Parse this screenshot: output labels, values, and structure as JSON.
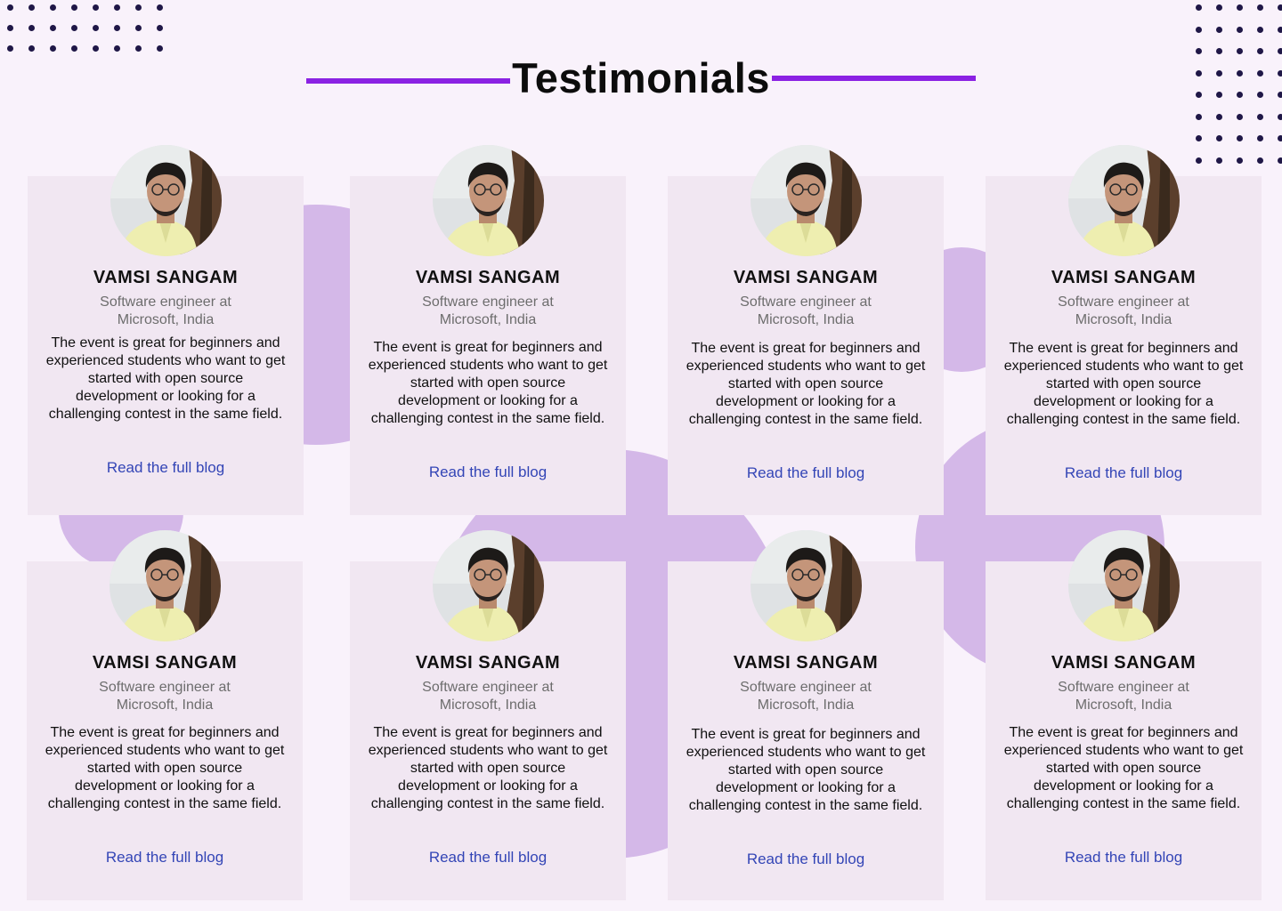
{
  "page": {
    "title": "Testimonials",
    "accent_color": "#8b22e3",
    "blob_color": "#d4b8e8",
    "link_color": "#3345b6"
  },
  "testimonials": [
    {
      "name": "VAMSI SANGAM",
      "role": "Software engineer at Microsoft, India",
      "quote": "The event is great for beginners and experienced students who want to get started with open source development or looking for a challenging contest in the same field.",
      "link": "Read the full blog"
    },
    {
      "name": "VAMSI SANGAM",
      "role": "Software engineer at Microsoft, India",
      "quote": "The event is great for beginners and experienced students who want to get started with open source development or looking for a challenging contest in the same field.",
      "link": "Read the full blog"
    },
    {
      "name": "VAMSI SANGAM",
      "role": "Software engineer at Microsoft, India",
      "quote": "The event is great for beginners and experienced students who want to get started with open source development or looking for a challenging contest in the same field.",
      "link": "Read the full blog"
    },
    {
      "name": "VAMSI SANGAM",
      "role": "Software engineer at Microsoft, India",
      "quote": "The event is great for beginners and experienced students who want to get started with open source development or looking for a challenging contest in the same field.",
      "link": "Read the full blog"
    },
    {
      "name": "VAMSI SANGAM",
      "role": "Software engineer at Microsoft, India",
      "quote": "The event is great for beginners and experienced students who want to get started with open source development or looking for a challenging contest in the same field.",
      "link": "Read the full blog"
    },
    {
      "name": "VAMSI SANGAM",
      "role": "Software engineer at Microsoft, India",
      "quote": "The event is great for beginners and experienced students who want to get started with open source development or looking for a challenging contest in the same field.",
      "link": "Read the full blog"
    },
    {
      "name": "VAMSI SANGAM",
      "role": "Software engineer at Microsoft, India",
      "quote": "The event is great for beginners and experienced students who want to get started with open source development or looking for a challenging contest in the same field.",
      "link": "Read the full blog"
    },
    {
      "name": "VAMSI SANGAM",
      "role": "Software engineer at Microsoft, India",
      "quote": "The event is great for beginners and experienced students who want to get started with open source development or looking for a challenging contest in the same field.",
      "link": "Read the full blog"
    }
  ]
}
